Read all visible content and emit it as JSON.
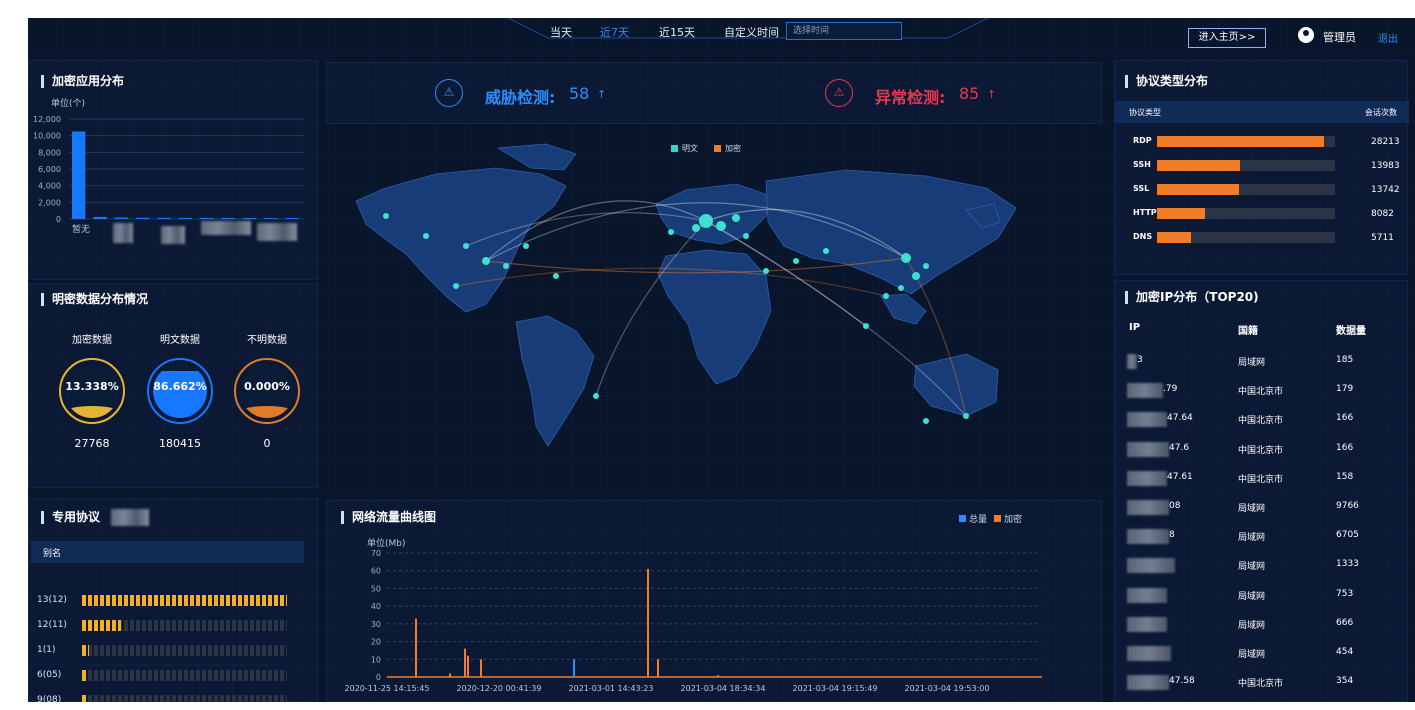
{
  "topnav": {
    "items": [
      "当天",
      "近7天",
      "近15天",
      "自定义时间"
    ],
    "active_index": 1,
    "time_placeholder": "选择时间",
    "enter_main": "进入主页>>",
    "user": "管理员",
    "logout": "退出"
  },
  "alerts": {
    "threat_label": "威胁检测:",
    "threat_value": "58",
    "abnormal_label": "异常检测:",
    "abnormal_value": "85",
    "arrow": "↑",
    "threat_color": "#2d8cff",
    "abnormal_color": "#e8384f"
  },
  "enc_app": {
    "title": "加密应用分布",
    "unit": "单位(个)",
    "first_category": "暂无",
    "chart_data": {
      "type": "bar",
      "categories": [
        "暂无",
        "",
        "",
        "",
        "",
        "",
        "",
        "",
        "",
        "",
        ""
      ],
      "values": [
        10500,
        250,
        180,
        150,
        140,
        130,
        130,
        120,
        120,
        110,
        110
      ],
      "ylim": [
        0,
        12000
      ],
      "yticks": [
        "12,000",
        "10,000",
        "8,000",
        "6,000",
        "4,000",
        "2,000",
        "0"
      ]
    }
  },
  "plain_dist": {
    "title": "明密数据分布情况",
    "items": [
      {
        "label": "加密数据",
        "pct": "13.338%",
        "count": "27768",
        "color": "#e6b336",
        "level": 0.13338
      },
      {
        "label": "明文数据",
        "pct": "86.662%",
        "count": "180415",
        "color": "#1677ff",
        "level": 0.86662
      },
      {
        "label": "不明数据",
        "pct": "0.000%",
        "count": "0",
        "color": "#e07b2c",
        "level": 0.0
      }
    ]
  },
  "private_proto": {
    "title": "专用协议",
    "header": "别名",
    "rows": [
      {
        "label": "13(12)",
        "fill": 1.0
      },
      {
        "label": "12(11)",
        "fill": 0.19
      },
      {
        "label": "1(1)",
        "fill": 0.035
      },
      {
        "label": "6(05)",
        "fill": 0.015
      },
      {
        "label": "9(08)",
        "fill": 0.015
      }
    ]
  },
  "map": {
    "legend": [
      "明文",
      "加密"
    ],
    "legend_colors": [
      "#2ad9c9",
      "#f27d29"
    ]
  },
  "traffic": {
    "title": "网络流量曲线图",
    "unit": "单位(Mb)",
    "legend": [
      "总量",
      "加密"
    ],
    "legend_colors": [
      "#2d8cff",
      "#f27d29"
    ],
    "chart_data": {
      "type": "bar",
      "ylim": [
        0,
        70
      ],
      "yticks": [
        "70",
        "60",
        "50",
        "40",
        "30",
        "20",
        "10",
        "0"
      ],
      "xticks": [
        "2020-11-25 14:15:45",
        "2020-12-20 00:41:39",
        "2021-03-01 14:43:23",
        "2021-03-04 18:34:34",
        "2021-03-04 19:15:49",
        "2021-03-04 19:53:00"
      ],
      "series": [
        {
          "name": "总量",
          "values": [
            10
          ]
        },
        {
          "name": "加密",
          "values": [
            33,
            2,
            16,
            12,
            10,
            61,
            10,
            1
          ]
        }
      ]
    }
  },
  "proto_type": {
    "title": "协议类型分布",
    "col1": "协议类型",
    "col2": "会话次数",
    "chart_data": {
      "type": "bar",
      "categories": [
        "RDP",
        "SSH",
        "SSL",
        "HTTP",
        "DNS"
      ],
      "values": [
        28213,
        13983,
        13742,
        8082,
        5711
      ],
      "xlim": [
        0,
        30000
      ]
    }
  },
  "enc_ip": {
    "title": "加密IP分布（TOP20)",
    "headers": [
      "IP",
      "国籍",
      "数据量"
    ],
    "rows": [
      {
        "ip": "3",
        "region": "局域网",
        "count": "185"
      },
      {
        "ip": ".79",
        "region": "中国北京市",
        "count": "179"
      },
      {
        "ip": "47.64",
        "region": "中国北京市",
        "count": "166"
      },
      {
        "ip": "47.6",
        "region": "中国北京市",
        "count": "166"
      },
      {
        "ip": "47.61",
        "region": "中国北京市",
        "count": "158"
      },
      {
        "ip": "08",
        "region": "局域网",
        "count": "9766"
      },
      {
        "ip": "8",
        "region": "局域网",
        "count": "6705"
      },
      {
        "ip": "",
        "region": "局域网",
        "count": "1333"
      },
      {
        "ip": "",
        "region": "局域网",
        "count": "753"
      },
      {
        "ip": "",
        "region": "局域网",
        "count": "666"
      },
      {
        "ip": "",
        "region": "局域网",
        "count": "454"
      },
      {
        "ip": "47.58",
        "region": "中国北京市",
        "count": "354"
      }
    ]
  }
}
